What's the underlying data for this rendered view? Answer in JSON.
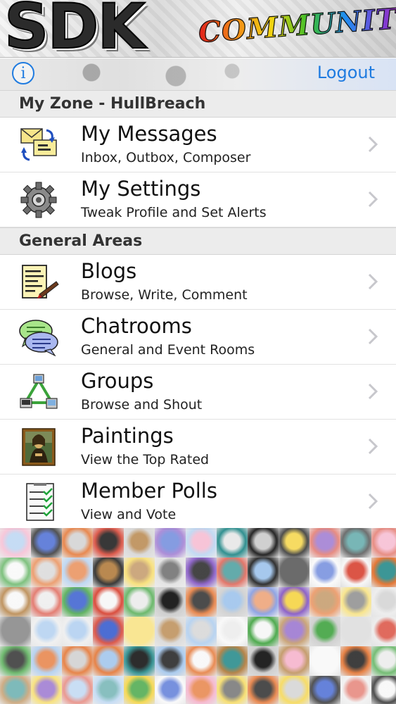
{
  "header": {
    "logo_main": "SDK",
    "logo_sub": "COMMUNITY"
  },
  "topbar": {
    "info_label": "i",
    "logout_label": "Logout"
  },
  "sections": [
    {
      "title": "My Zone - HullBreach",
      "items": [
        {
          "title": "My Messages",
          "subtitle": "Inbox, Outbox, Composer",
          "icon": "envelope-icon"
        },
        {
          "title": "My Settings",
          "subtitle": "Tweak Profile and Set Alerts",
          "icon": "gear-icon"
        }
      ]
    },
    {
      "title": "General Areas",
      "items": [
        {
          "title": "Blogs",
          "subtitle": "Browse, Write, Comment",
          "icon": "notepad-icon"
        },
        {
          "title": "Chatrooms",
          "subtitle": "General and Event Rooms",
          "icon": "chat-bubbles-icon"
        },
        {
          "title": "Groups",
          "subtitle": "Browse and Shout",
          "icon": "network-icon"
        },
        {
          "title": "Paintings",
          "subtitle": "View the Top Rated",
          "icon": "painting-icon"
        },
        {
          "title": "Member Polls",
          "subtitle": "View and Vote",
          "icon": "checklist-icon"
        }
      ]
    }
  ],
  "colors": {
    "accent": "#1f7be0",
    "section_bg": "#ececec",
    "chevron": "#c7c7cc"
  }
}
